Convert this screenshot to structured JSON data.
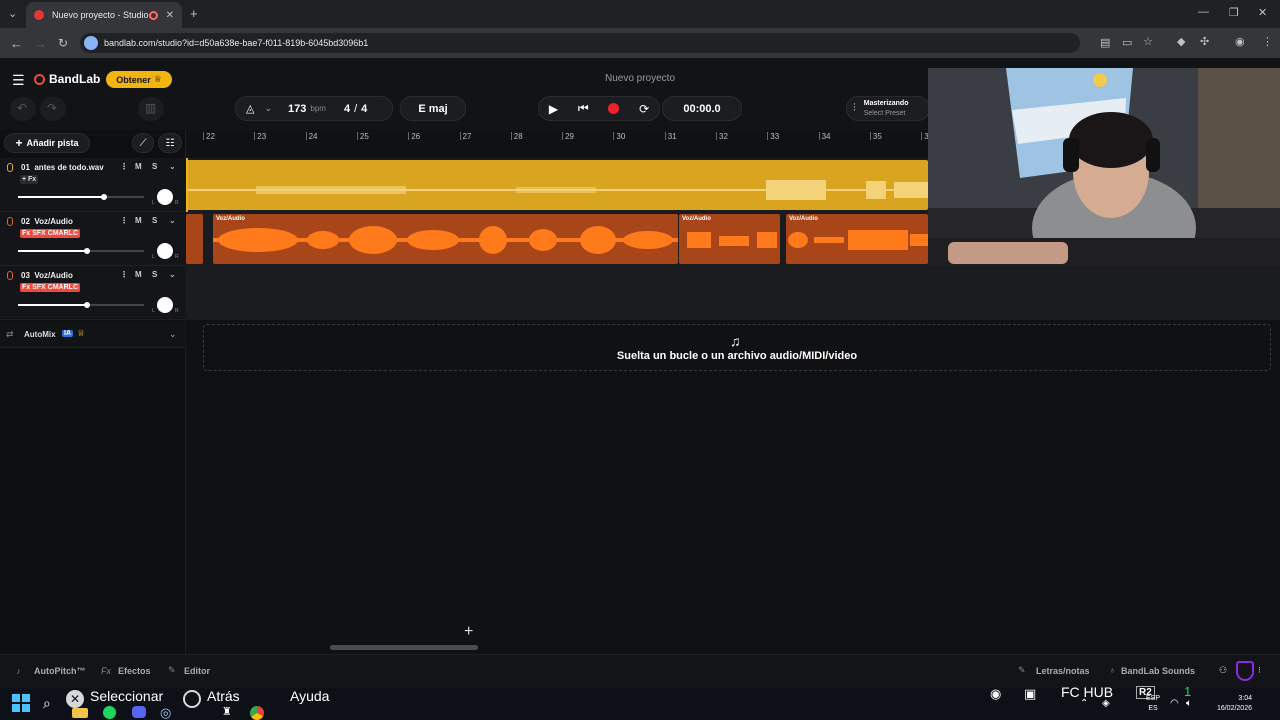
{
  "browser": {
    "tab_title": "Nuevo proyecto - Studio",
    "url": "bandlab.com/studio?id=d50a638e-bae7-f011-819b-6045bd3096b1"
  },
  "header": {
    "brand": "BandLab",
    "obtener_label": "Obtener",
    "project_title": "Nuevo proyecto"
  },
  "transport": {
    "bpm_value": "173",
    "bpm_unit": "bpm",
    "time_sig_num": "4",
    "time_sig_sep": "/",
    "time_sig_den": "4",
    "key": "E maj",
    "time": "00:00.0",
    "mastering_title": "Masterizando",
    "mastering_preset": "Select Preset"
  },
  "toolbar": {
    "add_track": "Añadir pista"
  },
  "ruler": {
    "bars": [
      "22",
      "23",
      "24",
      "25",
      "26",
      "27",
      "28",
      "29",
      "30",
      "31",
      "32",
      "33",
      "34",
      "35",
      "3"
    ]
  },
  "tracks": [
    {
      "number": "01",
      "name": "antes de todo.wav",
      "fx_label": "+ Fx",
      "mute": "M",
      "solo": "S",
      "volume": 0.68,
      "pan_l": "L",
      "pan_r": "R"
    },
    {
      "number": "02",
      "name": "Voz/Audio",
      "fx_label": "Fx SFX CMARLC",
      "mute": "M",
      "solo": "S",
      "volume": 0.55,
      "pan_l": "L",
      "pan_r": "R"
    },
    {
      "number": "03",
      "name": "Voz/Audio",
      "fx_label": "Fx SFX CMARLC",
      "mute": "M",
      "solo": "S",
      "volume": 0.55,
      "pan_l": "L",
      "pan_r": "R"
    }
  ],
  "regions": {
    "voz_label_1": "Voz/Audio",
    "voz_label_2": "Voz/Audio",
    "voz_label_3": "Voz/Audio"
  },
  "automix": {
    "label": "AutoMix",
    "badge": "IA"
  },
  "drop_zone": {
    "text": "Suelta un bucle o un archivo audio/MIDI/video"
  },
  "bottom_bar": {
    "autopitch": "AutoPitch™",
    "efectos_prefix": "Fx",
    "efectos": "Efectos",
    "editor": "Editor",
    "letras": "Letras/notas",
    "sounds": "BandLab Sounds"
  },
  "taskbar": {
    "seleccionar": "Seleccionar",
    "atras": "Atrás",
    "ayuda": "Ayuda",
    "fc_hub": "FC HUB",
    "r2": "R2",
    "one": "1",
    "lang_top": "ESP",
    "lang_bottom": "ES",
    "time": "3:04",
    "date": "16/02/2026"
  },
  "colors": {
    "track1": "#d9a520",
    "track1_dark": "#b8891a",
    "track2": "#e8631c",
    "track2_dark": "#a8461a",
    "accent": "#f2b40f",
    "record": "#f0202a"
  }
}
